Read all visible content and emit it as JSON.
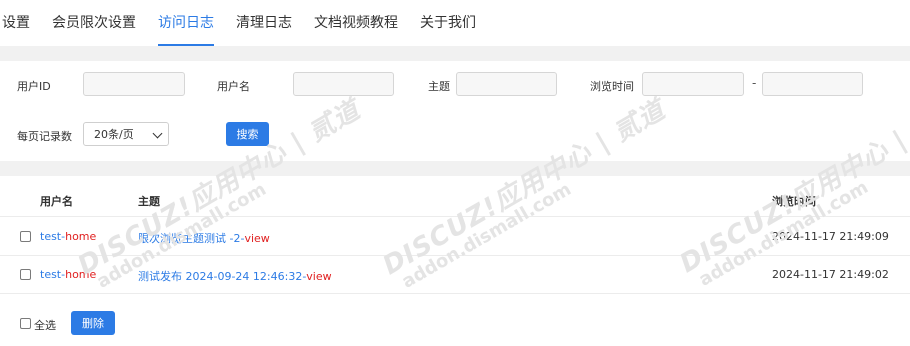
{
  "tabs": [
    {
      "label": "设置",
      "active": false
    },
    {
      "label": "会员限次设置",
      "active": false
    },
    {
      "label": "访问日志",
      "active": true
    },
    {
      "label": "清理日志",
      "active": false
    },
    {
      "label": "文档视频教程",
      "active": false
    },
    {
      "label": "关于我们",
      "active": false
    }
  ],
  "filters": {
    "user_id_label": "用户ID",
    "username_label": "用户名",
    "subject_label": "主题",
    "browse_time_label": "浏览时间",
    "range_separator": "-",
    "per_page_label": "每页记录数",
    "per_page_value": "20条/页",
    "search_button": "搜索"
  },
  "table": {
    "headers": {
      "username": "用户名",
      "subject": "主题",
      "time": "浏览时间"
    },
    "rows": [
      {
        "user_prefix": "test-",
        "user_suffix": "home",
        "subject_prefix": "限次浏览主题测试 -2-",
        "subject_suffix": "view",
        "time": "2024-11-17 21:49:09"
      },
      {
        "user_prefix": "test-",
        "user_suffix": "home",
        "subject_prefix": "测试发布 2024-09-24 12:46:32-",
        "subject_suffix": "view",
        "time": "2024-11-17 21:49:02"
      }
    ]
  },
  "footer": {
    "select_all_label": "全选",
    "delete_button": "删除"
  },
  "watermark": {
    "brand": "DISCUZ!应用中心 | 贰道",
    "domain": "addon.dismall.com"
  },
  "colors": {
    "accent": "#2c7be5",
    "highlight": "#e02020",
    "band": "#f1f1f1"
  }
}
